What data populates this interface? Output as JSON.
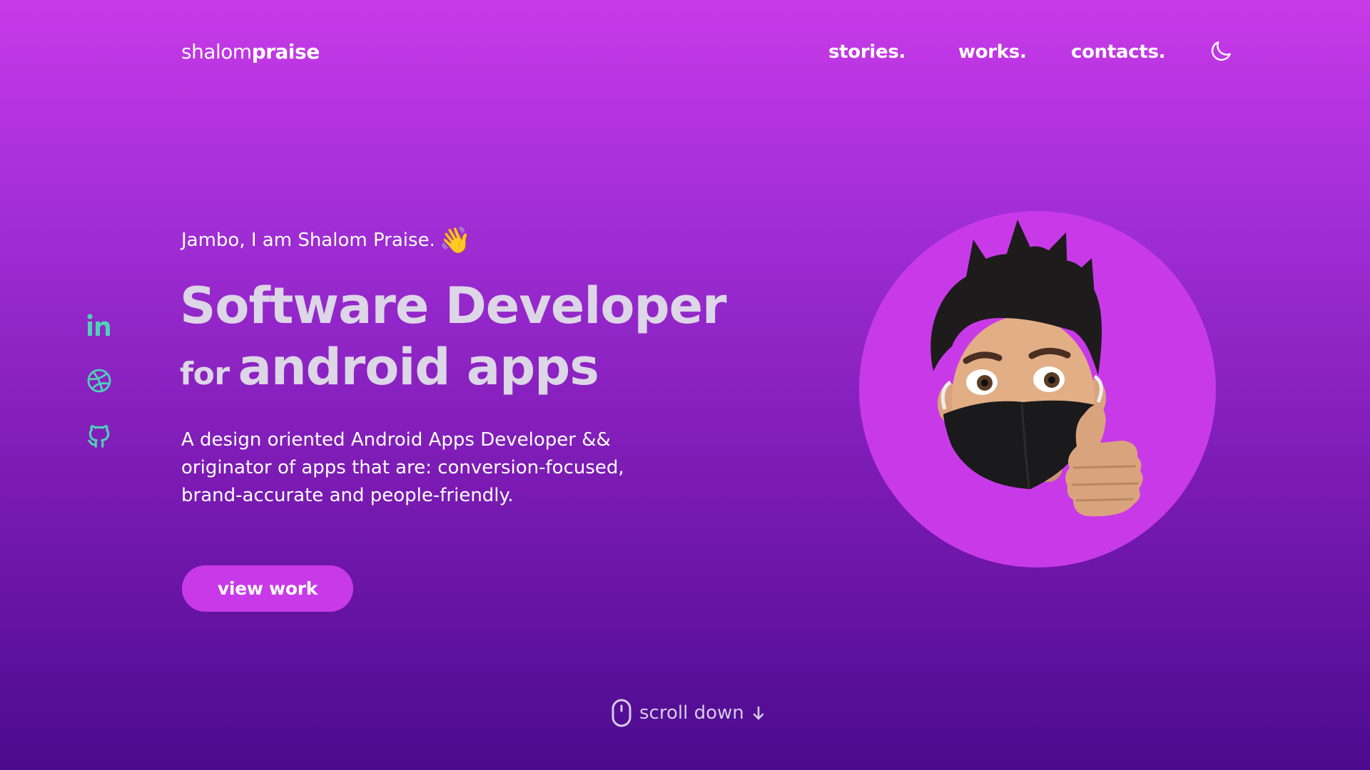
{
  "header": {
    "logo_light": "shalom",
    "logo_bold": "praise",
    "nav": [
      {
        "label": "stories."
      },
      {
        "label": "works."
      },
      {
        "label": "contacts."
      }
    ],
    "theme_icon": "moon-icon"
  },
  "social": [
    {
      "icon": "linkedin-icon"
    },
    {
      "icon": "dribbble-icon"
    },
    {
      "icon": "github-icon"
    }
  ],
  "hero": {
    "greeting": "Jambo, I am Shalom Praise.",
    "wave_emoji": "👋",
    "headline_line1": "Software Developer",
    "headline_small": "for",
    "headline_big": "android apps",
    "description": "A design oriented Android Apps Developer && originator of apps that are: conversion-focused, brand-accurate and people-friendly.",
    "cta_label": "view work"
  },
  "scroll": {
    "label": "scroll down"
  },
  "colors": {
    "accent": "#c83ae8",
    "social_icon": "#4fd1b8",
    "headline": "#dcd6e6",
    "bg_top": "#c83ae8",
    "bg_bottom": "#4b0b8e"
  }
}
